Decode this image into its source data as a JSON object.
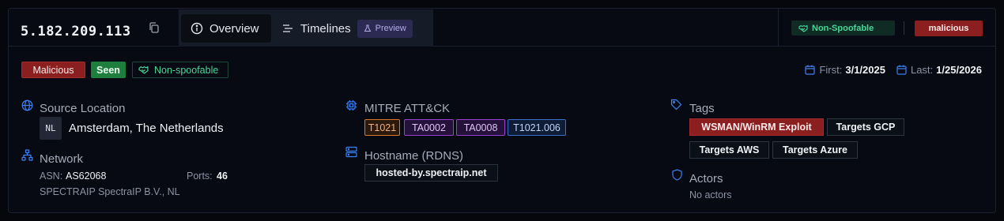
{
  "header": {
    "ip": "5.182.209.113",
    "tabs": [
      {
        "label": "Overview",
        "icon": "info-circle-icon",
        "active": true
      },
      {
        "label": "Timelines",
        "icon": "list-icon",
        "active": false,
        "badge": "Preview",
        "badge_icon": "flask-icon"
      }
    ],
    "non_spoofable": "Non-Spoofable",
    "malicious": "malicious"
  },
  "badges": {
    "malicious": "Malicious",
    "seen": "Seen",
    "non_spoofable": "Non-spoofable"
  },
  "dates": {
    "first_label": "First:",
    "first_value": "3/1/2025",
    "last_label": "Last:",
    "last_value": "1/25/2026"
  },
  "source_location": {
    "title": "Source Location",
    "country_code": "NL",
    "location": "Amsterdam, The Netherlands"
  },
  "network": {
    "title": "Network",
    "asn_label": "ASN:",
    "asn_value": "AS62068",
    "ports_label": "Ports:",
    "ports_value": "46",
    "org": "SPECTRAIP SpectraIP B.V., NL"
  },
  "mitre": {
    "title": "MITRE ATT&CK",
    "techniques": [
      "T1021",
      "TA0002",
      "TA0008",
      "T1021.006"
    ]
  },
  "hostname": {
    "title": "Hostname (RDNS)",
    "value": "hosted-by.spectraip.net"
  },
  "tags": {
    "title": "Tags",
    "items": [
      "WSMAN/WinRM Exploit",
      "Targets GCP",
      "Targets AWS",
      "Targets Azure"
    ]
  },
  "actors": {
    "title": "Actors",
    "empty_text": "No actors"
  },
  "colors": {
    "background": "#05070d",
    "malicious": "#8b1e1e",
    "seen": "#1e7e3e",
    "non_spoofable": "#4ad39b",
    "accent_blue": "#3b82f6"
  }
}
